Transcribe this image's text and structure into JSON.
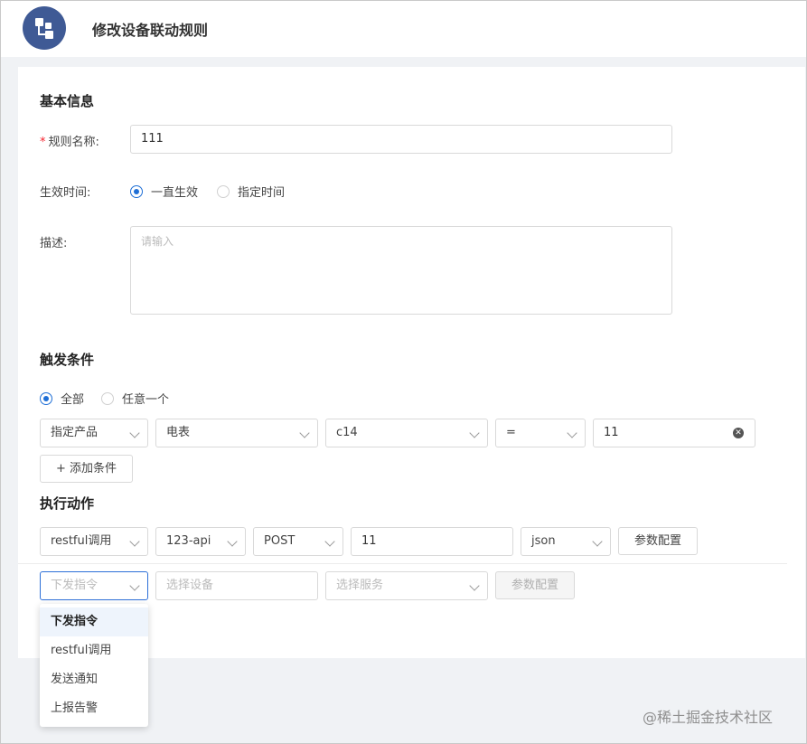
{
  "header": {
    "title": "修改设备联动规则",
    "logo_icon": "flow-icon"
  },
  "basic": {
    "section_title": "基本信息",
    "rule_name": {
      "label": "规则名称:",
      "required_mark": "*",
      "value": "111"
    },
    "effective_time": {
      "label": "生效时间:",
      "options": [
        "一直生效",
        "指定时间"
      ],
      "selected": "一直生效"
    },
    "description": {
      "label": "描述:",
      "placeholder": "请输入"
    }
  },
  "trigger": {
    "section_title": "触发条件",
    "mode_options": [
      "全部",
      "任意一个"
    ],
    "mode_selected": "全部",
    "condition": {
      "target": "指定产品",
      "product": "电表",
      "property": "c14",
      "operator": "=",
      "value": "11"
    },
    "add_button": "+ 添加条件"
  },
  "action": {
    "section_title": "执行动作",
    "row1": {
      "type": "restful调用",
      "api": "123-api",
      "method": "POST",
      "value": "11",
      "format": "json",
      "config_button": "参数配置"
    },
    "row2": {
      "type_placeholder": "下发指令",
      "device_placeholder": "选择设备",
      "service_placeholder": "选择服务",
      "config_button": "参数配置"
    },
    "dropdown_options": [
      "下发指令",
      "restful调用",
      "发送通知",
      "上报告警"
    ],
    "dropdown_selected": "下发指令"
  },
  "watermark": "@稀土掘金技术社区",
  "colors": {
    "primary": "#1f6fd6",
    "logo_bg": "#3f5a95",
    "required": "#f5222d"
  }
}
